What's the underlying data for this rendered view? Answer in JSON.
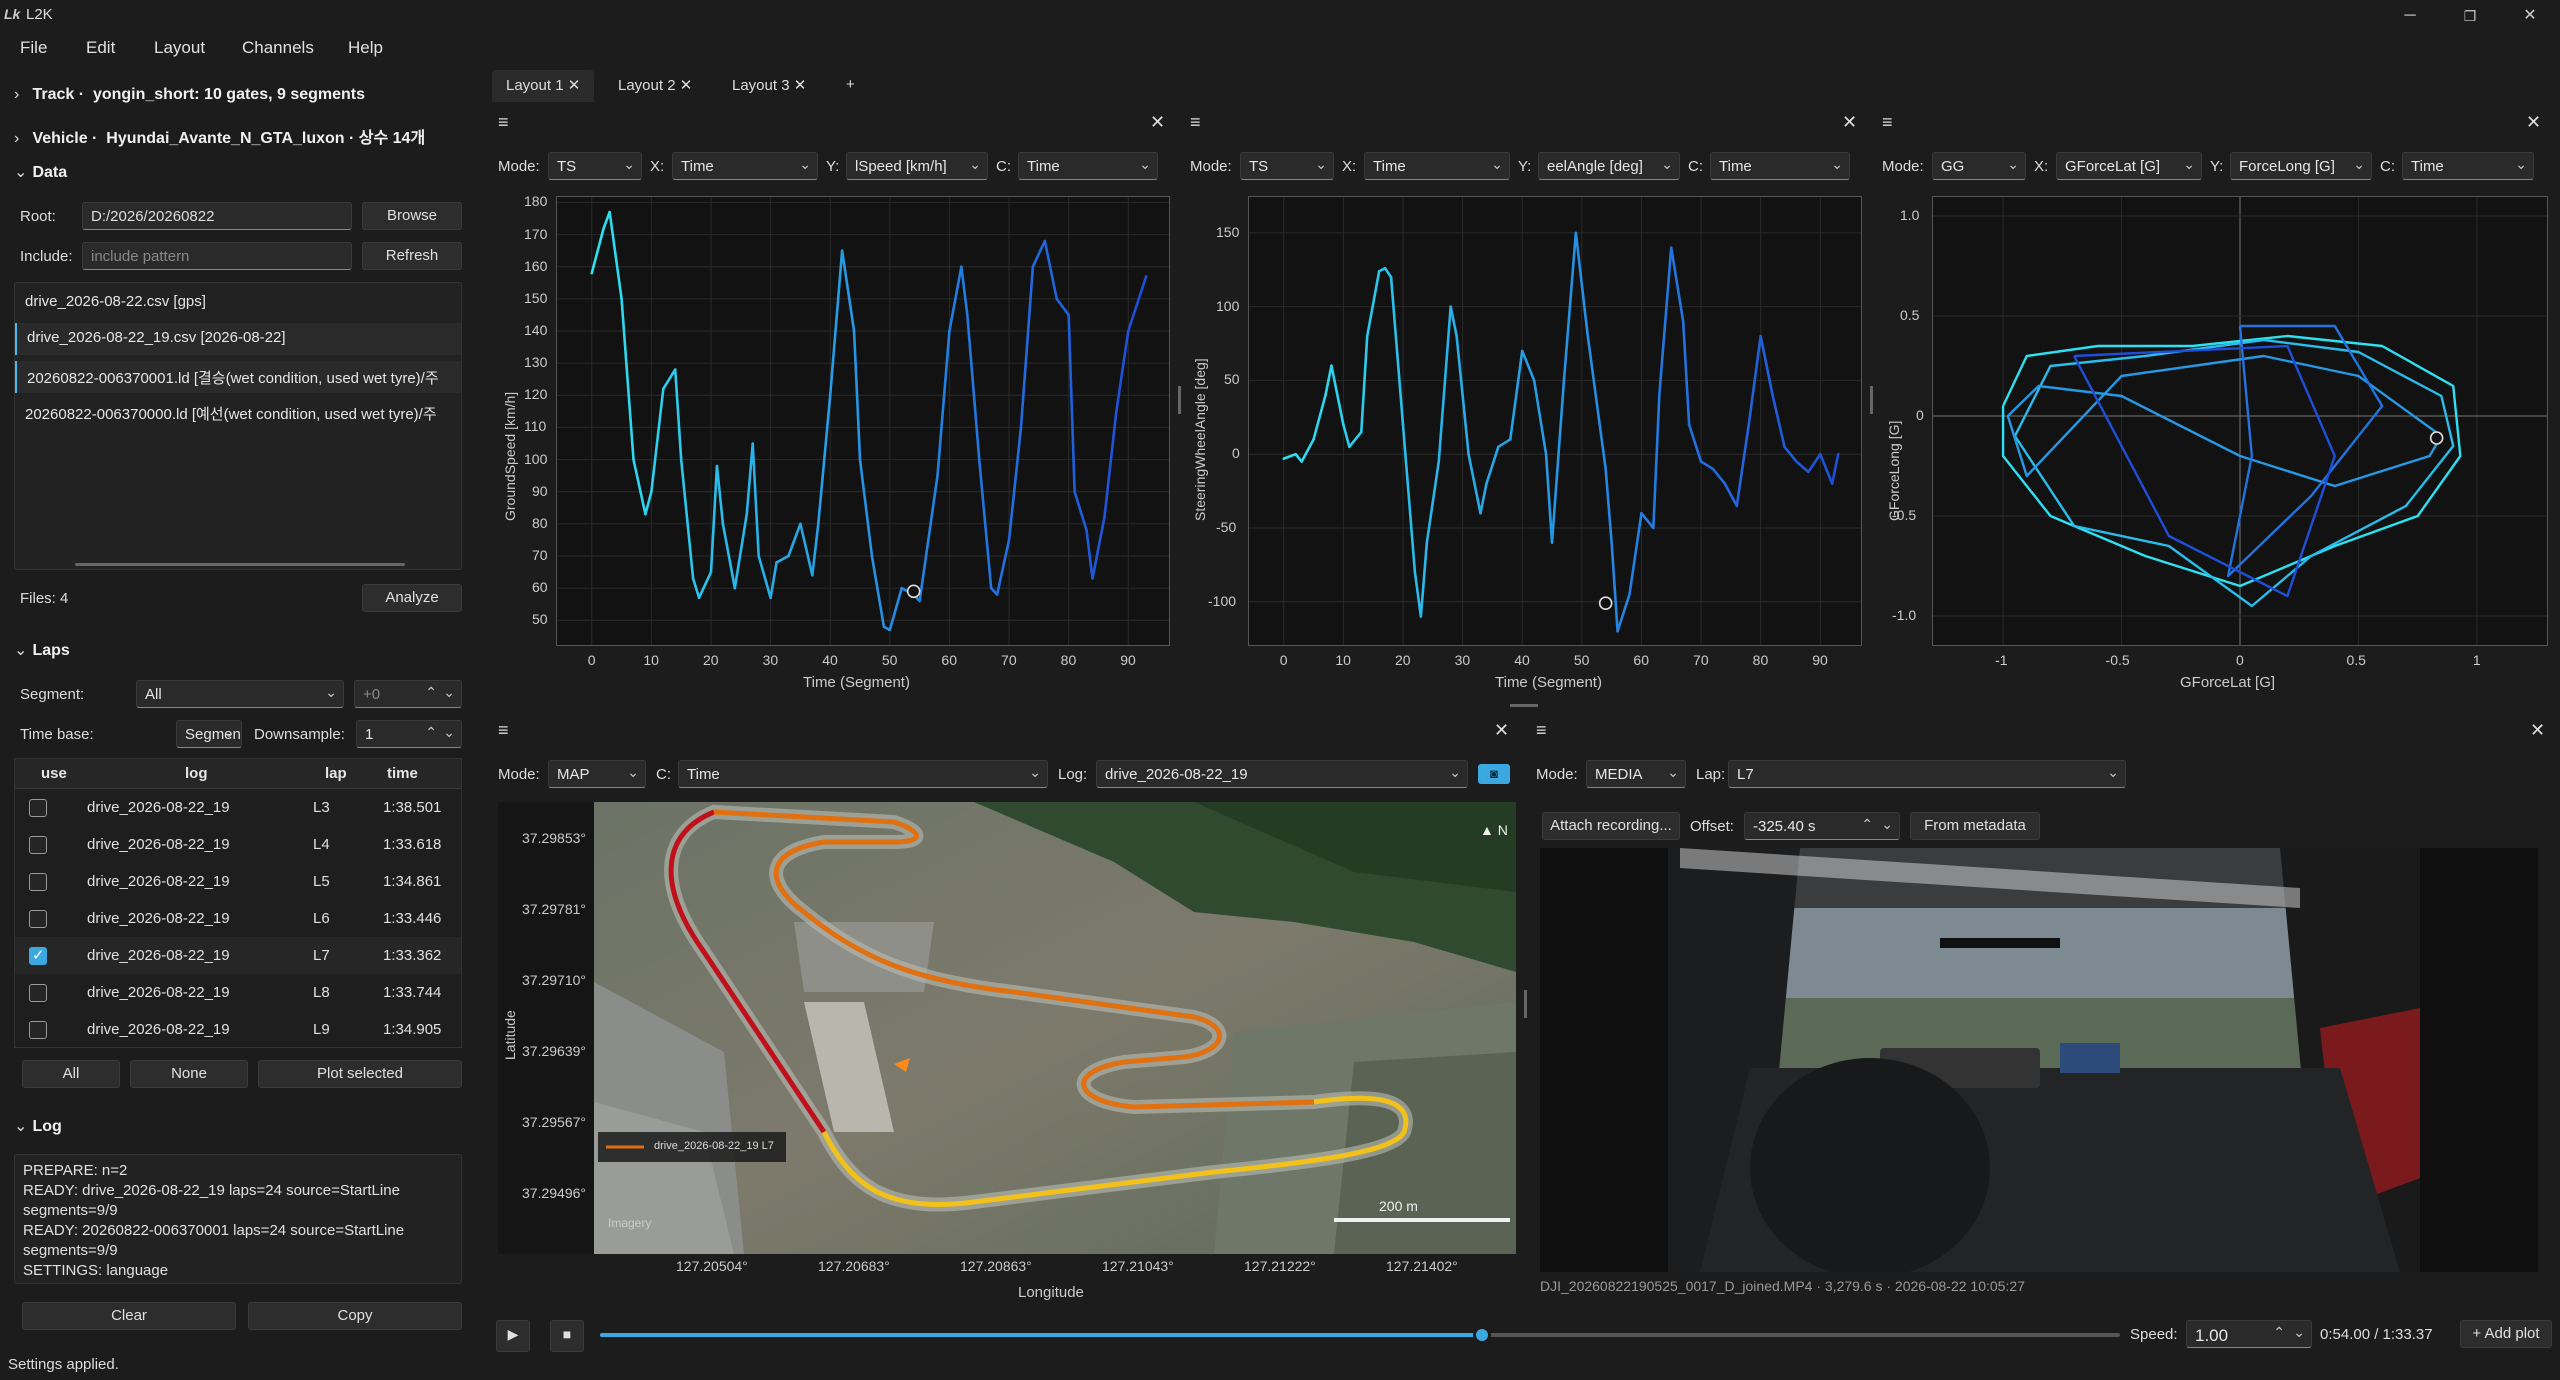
{
  "app": {
    "icon": "Lk",
    "title": "L2K",
    "status": "Settings applied."
  },
  "menu": [
    "File",
    "Edit",
    "Layout",
    "Channels",
    "Help"
  ],
  "sidebar": {
    "track": {
      "label": "Track",
      "value": "yongin_short: 10 gates, 9 segments"
    },
    "vehicle": {
      "label": "Vehicle",
      "value": "Hyundai_Avante_N_GTA_luxon · 상수 14개"
    },
    "data": {
      "label": "Data",
      "root_label": "Root:",
      "root_value": "D:/2026/20260822",
      "browse": "Browse",
      "include_label": "Include:",
      "include_placeholder": "include pattern",
      "refresh": "Refresh",
      "files": [
        "drive_2026-08-22.csv [gps]",
        "drive_2026-08-22_19.csv [2026-08-22]",
        "20260822-006370001.ld [결승(wet condition, used wet tyre)/주",
        "20260822-006370000.ld [예선(wet condition, used wet tyre)/주"
      ],
      "files_count": "Files: 4",
      "analyze": "Analyze"
    },
    "laps": {
      "label": "Laps",
      "segment_label": "Segment:",
      "segment_value": "All",
      "offset_value": "+0",
      "timebase_label": "Time base:",
      "timebase_value": "Segment",
      "downsample_label": "Downsample:",
      "downsample_value": "1",
      "columns": [
        "use",
        "log",
        "lap",
        "time"
      ],
      "rows": [
        {
          "log": "drive_2026-08-22_19",
          "lap": "L3",
          "time": "1:38.501",
          "checked": false
        },
        {
          "log": "drive_2026-08-22_19",
          "lap": "L4",
          "time": "1:33.618",
          "checked": false
        },
        {
          "log": "drive_2026-08-22_19",
          "lap": "L5",
          "time": "1:34.861",
          "checked": false
        },
        {
          "log": "drive_2026-08-22_19",
          "lap": "L6",
          "time": "1:33.446",
          "checked": false
        },
        {
          "log": "drive_2026-08-22_19",
          "lap": "L7",
          "time": "1:33.362",
          "checked": true
        },
        {
          "log": "drive_2026-08-22_19",
          "lap": "L8",
          "time": "1:33.744",
          "checked": false
        },
        {
          "log": "drive_2026-08-22_19",
          "lap": "L9",
          "time": "1:34.905",
          "checked": false
        }
      ],
      "btn_all": "All",
      "btn_none": "None",
      "btn_plot": "Plot selected"
    },
    "log": {
      "label": "Log",
      "text": "PREPARE: n=2\nREADY: drive_2026-08-22_19 laps=24 source=StartLine\nsegments=9/9\nREADY: 20260822-006370001 laps=24 source=StartLine\nsegments=9/9\nSETTINGS: language",
      "clear": "Clear",
      "copy": "Copy"
    }
  },
  "tabs": [
    "Layout 1",
    "Layout 2",
    "Layout 3",
    "+"
  ],
  "plots": [
    {
      "mode_label": "Mode:",
      "mode": "TS",
      "x_label": "X:",
      "x": "Time",
      "y_label": "Y:",
      "y": "lSpeed [km/h]",
      "c_label": "C:",
      "c": "Time",
      "ylabel": "GroundSpeed [km/h]",
      "xlabel": "Time (Segment)"
    },
    {
      "mode_label": "Mode:",
      "mode": "TS",
      "x_label": "X:",
      "x": "Time",
      "y_label": "Y:",
      "y": "eelAngle [deg]",
      "c_label": "C:",
      "c": "Time",
      "ylabel": "SteeringWheelAngle [deg]",
      "xlabel": "Time (Segment)"
    },
    {
      "mode_label": "Mode:",
      "mode": "GG",
      "x_label": "X:",
      "x": "GForceLat [G]",
      "y_label": "Y:",
      "y": "ForceLong [G]",
      "c_label": "C:",
      "c": "Time",
      "ylabel": "GForceLong [G]",
      "xlabel": "GForceLat [G]"
    }
  ],
  "chart_data": [
    {
      "type": "line",
      "xlabel": "Time (Segment)",
      "ylabel": "GroundSpeed [km/h]",
      "xlim": [
        -6,
        97
      ],
      "ylim": [
        42,
        182
      ],
      "xticks": [
        0,
        10,
        20,
        30,
        40,
        50,
        60,
        70,
        80,
        90
      ],
      "yticks": [
        50,
        60,
        70,
        80,
        90,
        100,
        110,
        120,
        130,
        140,
        150,
        160,
        170,
        180
      ],
      "series": [
        {
          "x": [
            0,
            2,
            3,
            5,
            7,
            9,
            10,
            12,
            14,
            15,
            17,
            18,
            20,
            21,
            22,
            24,
            26,
            27,
            28,
            30,
            31,
            33,
            35,
            37,
            38,
            40,
            42,
            44,
            45,
            47,
            49,
            50,
            52,
            54,
            55,
            58,
            60,
            62,
            63,
            65,
            67,
            68,
            70,
            72,
            74,
            76,
            78,
            80,
            81,
            83,
            84,
            86,
            88,
            90,
            93
          ],
          "y": [
            158,
            172,
            177,
            150,
            100,
            83,
            90,
            122,
            128,
            100,
            63,
            57,
            65,
            98,
            80,
            60,
            83,
            105,
            70,
            57,
            68,
            70,
            80,
            64,
            80,
            120,
            165,
            140,
            100,
            70,
            48,
            47,
            60,
            58,
            56,
            95,
            140,
            160,
            145,
            100,
            60,
            58,
            75,
            110,
            160,
            168,
            150,
            145,
            90,
            78,
            63,
            82,
            115,
            140,
            157
          ]
        }
      ],
      "marker": {
        "x": 54,
        "y": 59
      }
    },
    {
      "type": "line",
      "xlabel": "Time (Segment)",
      "ylabel": "SteeringWheelAngle [deg]",
      "xlim": [
        -6,
        97
      ],
      "ylim": [
        -130,
        175
      ],
      "xticks": [
        0,
        10,
        20,
        30,
        40,
        50,
        60,
        70,
        80,
        90
      ],
      "yticks": [
        -100,
        -50,
        0,
        50,
        100,
        150
      ],
      "series": [
        {
          "x": [
            0,
            2,
            3,
            5,
            7,
            8,
            10,
            11,
            13,
            14,
            16,
            17,
            18,
            20,
            22,
            23,
            24,
            26,
            28,
            29,
            31,
            33,
            34,
            36,
            38,
            40,
            42,
            44,
            45,
            47,
            49,
            51,
            53,
            54,
            55,
            56,
            58,
            60,
            62,
            63,
            65,
            67,
            68,
            70,
            72,
            74,
            76,
            78,
            80,
            82,
            84,
            86,
            88,
            90,
            92,
            93
          ],
          "y": [
            -3,
            0,
            -5,
            10,
            40,
            60,
            20,
            5,
            15,
            80,
            124,
            126,
            120,
            20,
            -80,
            -110,
            -60,
            -5,
            100,
            80,
            0,
            -40,
            -20,
            5,
            10,
            70,
            50,
            0,
            -60,
            50,
            150,
            80,
            20,
            -10,
            -60,
            -120,
            -95,
            -40,
            -50,
            40,
            140,
            90,
            20,
            -5,
            -10,
            -20,
            -35,
            20,
            80,
            40,
            5,
            -5,
            -12,
            0,
            -20,
            0
          ]
        }
      ],
      "marker": {
        "x": 54,
        "y": -101
      }
    },
    {
      "type": "scatter",
      "xlabel": "GForceLat [G]",
      "ylabel": "GForceLong [G]",
      "xlim": [
        -1.3,
        1.3
      ],
      "ylim": [
        -1.15,
        1.1
      ],
      "xticks": [
        -1,
        -0.5,
        0,
        0.5,
        1
      ],
      "yticks": [
        -1.0,
        -0.5,
        0,
        0.5,
        1.0
      ],
      "marker": {
        "x": 0.83,
        "y": -0.11
      }
    }
  ],
  "map": {
    "mode_label": "Mode:",
    "mode": "MAP",
    "c_label": "C:",
    "c": "Time",
    "log_label": "Log:",
    "log": "drive_2026-08-22_19",
    "yticks": [
      "37.29853°",
      "37.29781°",
      "37.29710°",
      "37.29639°",
      "37.29567°",
      "37.29496°"
    ],
    "xticks": [
      "127.20504°",
      "127.20683°",
      "127.20863°",
      "127.21043°",
      "127.21222°",
      "127.21402°"
    ],
    "ylabel": "Latitude",
    "xlabel": "Longitude",
    "legend": "drive_2026-08-22_19 L7",
    "scale": "200 m",
    "north": "N",
    "imagery": "Imagery"
  },
  "media": {
    "mode_label": "Mode:",
    "mode": "MEDIA",
    "lap_label": "Lap:",
    "lap": "L7",
    "attach": "Attach recording...",
    "offset_label": "Offset:",
    "offset": "-325.40 s",
    "from_meta": "From metadata",
    "caption": "DJI_20260822190525_0017_D_joined.MP4  ·  3,279.6 s  ·  2026-08-22 10:05:27"
  },
  "transport": {
    "speed_label": "Speed:",
    "speed": "1.00",
    "position": "0:54.00 / 1:33.37",
    "add_plot": "+ Add plot",
    "progress": 0.58
  },
  "colors": {
    "accent": "#3ba9e0",
    "cyan": "#2ee0f0",
    "blue": "#1f4fd8"
  }
}
